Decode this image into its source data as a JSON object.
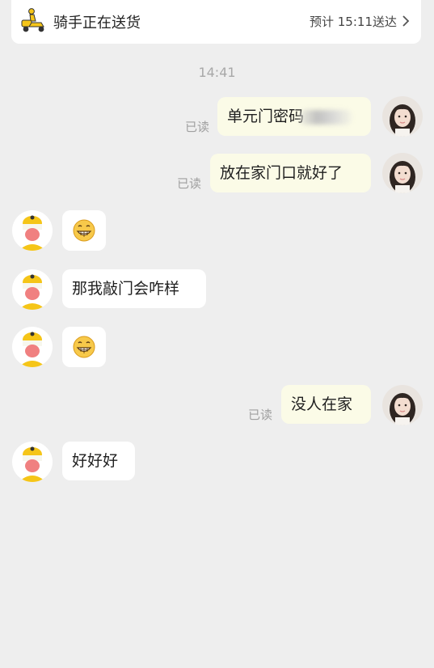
{
  "banner": {
    "title": "骑手正在送货",
    "eta": "预计 15:11送达",
    "scooter_icon": "scooter-icon",
    "chevron_icon": "chevron-right-icon"
  },
  "chat": {
    "timestamp": "14:41",
    "read_label": "已读",
    "messages": [
      {
        "from": "me",
        "text": "单元门密码",
        "read": "已读",
        "redacted": true
      },
      {
        "from": "me",
        "text": "放在家门口就好了",
        "read": "已读"
      },
      {
        "from": "rider",
        "emoji": "grin-emoji"
      },
      {
        "from": "rider",
        "text": "那我敲门会咋样"
      },
      {
        "from": "rider",
        "emoji": "grin-emoji"
      },
      {
        "from": "me",
        "text": "没人在家",
        "read": "已读"
      },
      {
        "from": "rider",
        "text": "好好好"
      }
    ]
  },
  "colors": {
    "background": "#eeeeee",
    "my_bubble": "#fbfbe7",
    "other_bubble": "#ffffff",
    "rider_yellow": "#f5c518"
  }
}
